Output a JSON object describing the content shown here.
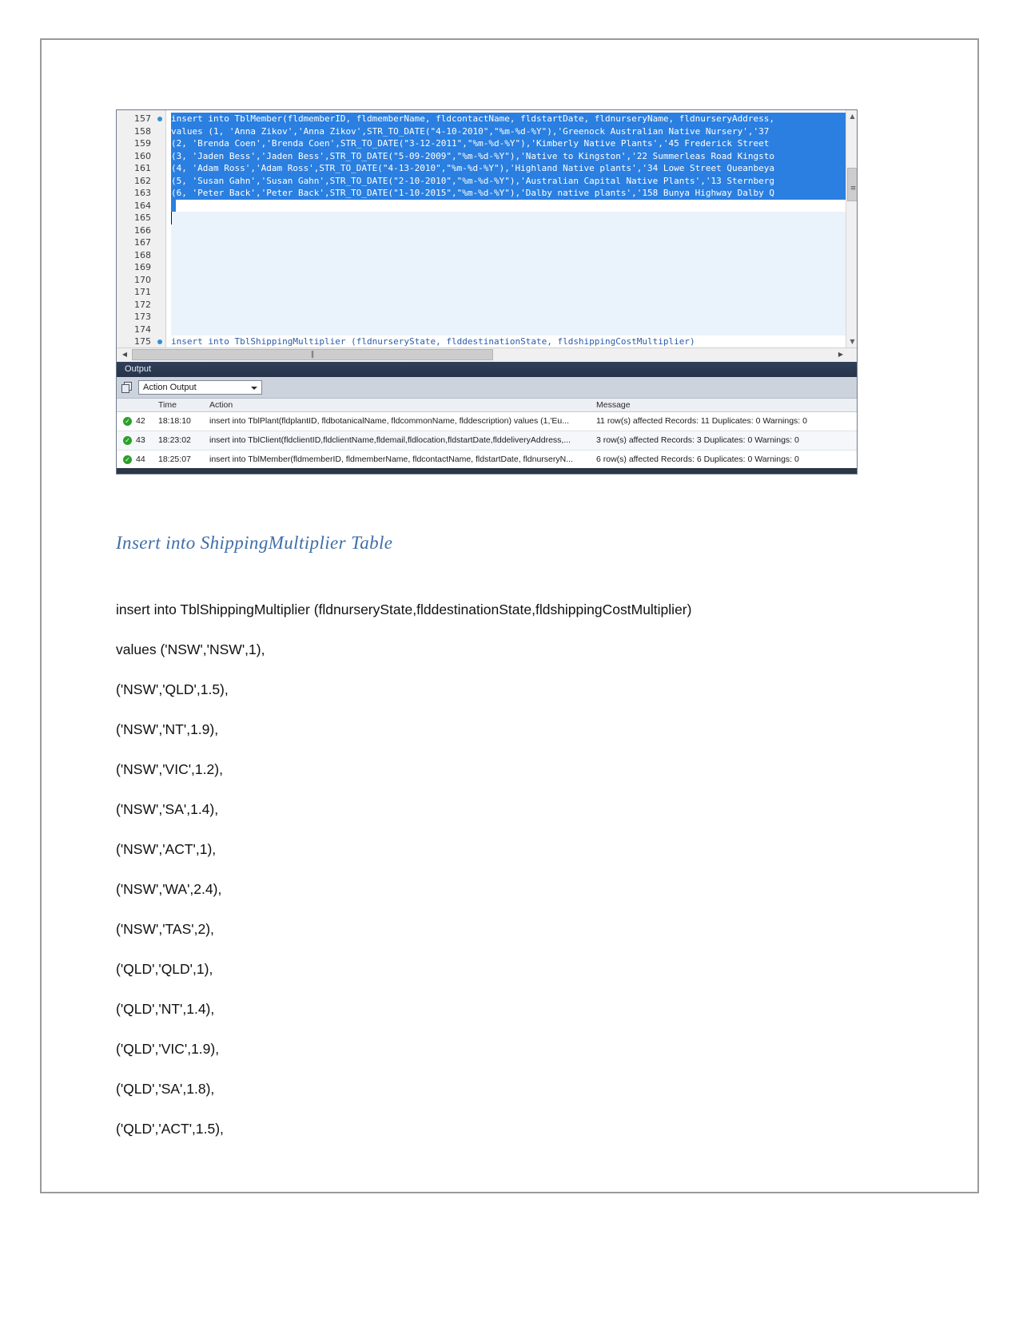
{
  "editor": {
    "lines": [
      {
        "num": "157",
        "breakpoint": true,
        "text": "insert into TblMember(fldmemberID, fldmemberName, fldcontactName, fldstartDate, fldnurseryName, fldnurseryAddress,",
        "selected": true
      },
      {
        "num": "158",
        "breakpoint": false,
        "text": "values (1, 'Anna Zikov','Anna Zikov',STR_TO_DATE(\"4-10-2010\",\"%m-%d-%Y\"),'Greenock Australian Native Nursery','37",
        "selected": true
      },
      {
        "num": "159",
        "breakpoint": false,
        "text": "(2, 'Brenda Coen','Brenda Coen',STR_TO_DATE(\"3-12-2011\",\"%m-%d-%Y\"),'Kimberly Native Plants','45 Frederick Street",
        "selected": true
      },
      {
        "num": "160",
        "breakpoint": false,
        "text": "(3, 'Jaden Bess','Jaden Bess',STR_TO_DATE(\"5-09-2009\",\"%m-%d-%Y\"),'Native to Kingston','22 Summerleas Road Kingsto",
        "selected": true
      },
      {
        "num": "161",
        "breakpoint": false,
        "text": "(4, 'Adam Ross','Adam Ross',STR_TO_DATE(\"4-13-2010\",\"%m-%d-%Y\"),'Highland Native plants','34 Lowe Street Queanbeya",
        "selected": true
      },
      {
        "num": "162",
        "breakpoint": false,
        "text": "(5, 'Susan Gahn','Susan Gahn',STR_TO_DATE(\"2-10-2010\",\"%m-%d-%Y\"),'Australian Capital Native Plants','13 Sternberg",
        "selected": true
      },
      {
        "num": "163",
        "breakpoint": false,
        "text": "(6, 'Peter Back','Peter Back',STR_TO_DATE(\"1-10-2015\",\"%m-%d-%Y\"),'Dalby native plants','158 Bunya Highway Dalby Q",
        "selected": true
      },
      {
        "num": "164",
        "breakpoint": false,
        "text": "",
        "selected": true
      },
      {
        "num": "165",
        "breakpoint": false,
        "text": "",
        "selected": false,
        "caret": true
      },
      {
        "num": "166",
        "breakpoint": false,
        "text": "",
        "selected": false
      },
      {
        "num": "167",
        "breakpoint": false,
        "text": "",
        "selected": false
      },
      {
        "num": "168",
        "breakpoint": false,
        "text": "",
        "selected": false
      },
      {
        "num": "169",
        "breakpoint": false,
        "text": "",
        "selected": false
      },
      {
        "num": "170",
        "breakpoint": false,
        "text": "",
        "selected": false
      },
      {
        "num": "171",
        "breakpoint": false,
        "text": "",
        "selected": false
      },
      {
        "num": "172",
        "breakpoint": false,
        "text": "",
        "selected": false
      },
      {
        "num": "173",
        "breakpoint": false,
        "text": "",
        "selected": false
      },
      {
        "num": "174",
        "breakpoint": false,
        "text": "",
        "selected": false
      },
      {
        "num": "175",
        "breakpoint": true,
        "text": "insert into TblShippingMultiplier (fldnurseryState, flddestinationState, fldshippingCostMultiplier)",
        "selected": false,
        "bottom": true
      }
    ],
    "scroll_left_arrow": "◀",
    "scroll_right_arrow": "▶",
    "scroll_up_arrow": "▲",
    "scroll_down_arrow": "▼",
    "h_thumb_grip": "‖",
    "v_grip": "≡"
  },
  "output_panel": {
    "title": "Output",
    "selector_value": "Action Output",
    "columns": {
      "num": "",
      "time": "Time",
      "action": "Action",
      "message": "Message"
    },
    "rows": [
      {
        "status": "✓",
        "num": "42",
        "time": "18:18:10",
        "action": "insert into TblPlant(fldplantID, fldbotanicalName, fldcommonName, flddescription) values (1,'Eu...",
        "message": "11 row(s) affected Records: 11  Duplicates: 0  Warnings: 0"
      },
      {
        "status": "✓",
        "num": "43",
        "time": "18:23:02",
        "action": "insert into TblClient(fldclientID,fldclientName,fldemail,fldlocation,fldstartDate,flddeliveryAddress,...",
        "message": "3 row(s) affected Records: 3  Duplicates: 0  Warnings: 0"
      },
      {
        "status": "✓",
        "num": "44",
        "time": "18:25:07",
        "action": "insert into TblMember(fldmemberID, fldmemberName, fldcontactName, fldstartDate, fldnurseryN...",
        "message": "6 row(s) affected Records: 6  Duplicates: 0  Warnings: 0"
      }
    ]
  },
  "document": {
    "heading": "Insert into ShippingMultiplier Table",
    "lines": [
      "insert into TblShippingMultiplier (fldnurseryState,flddestinationState,fldshippingCostMultiplier)",
      "values ('NSW','NSW',1),",
      "('NSW','QLD',1.5),",
      "('NSW','NT',1.9),",
      "('NSW','VIC',1.2),",
      "('NSW','SA',1.4),",
      "('NSW','ACT',1),",
      "('NSW','WA',2.4),",
      "('NSW','TAS',2),",
      "('QLD','QLD',1),",
      "('QLD','NT',1.4),",
      "('QLD','VIC',1.9),",
      "('QLD','SA',1.8),",
      "('QLD','ACT',1.5),"
    ]
  },
  "colors": {
    "heading": "#3f6ea8",
    "selection": "#2a7fe0",
    "output_titlebar": "#2b3647",
    "status_ok": "#2aa02a"
  }
}
